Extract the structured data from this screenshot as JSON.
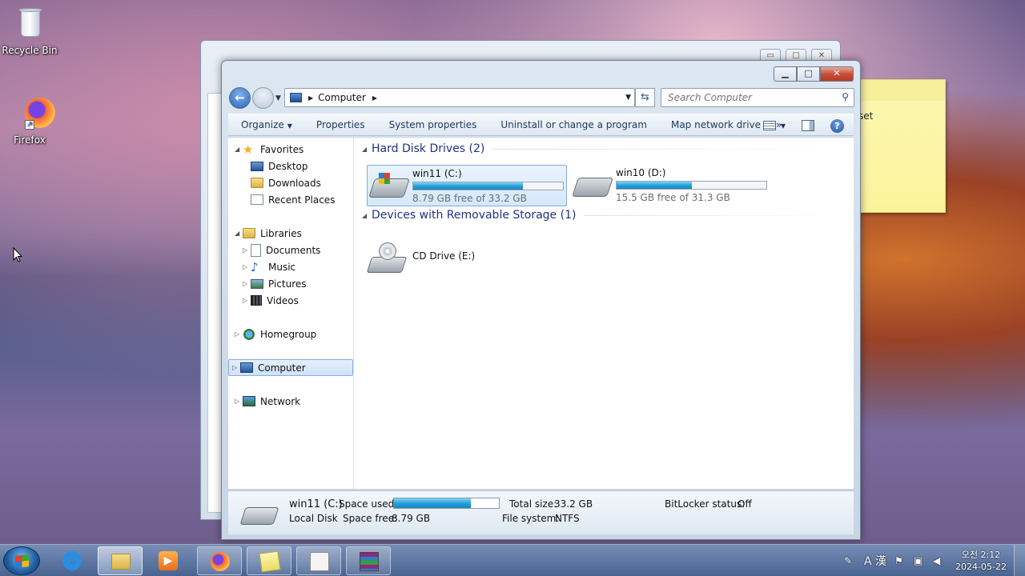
{
  "desktop": {
    "icons": [
      {
        "label": "Recycle Bin",
        "icon": "recycle-bin-icon"
      },
      {
        "label": "Firefox",
        "icon": "firefox-icon"
      }
    ],
    "sticky_note_text": "set"
  },
  "explorer": {
    "window_buttons": {
      "minimize": "▭",
      "maximize": "□",
      "close": "✕"
    },
    "address": {
      "crumb": "Computer",
      "search_placeholder": "Search Computer"
    },
    "toolbar": {
      "organize": "Organize",
      "properties": "Properties",
      "system_properties": "System properties",
      "uninstall": "Uninstall or change a program",
      "map_network_drive": "Map network drive",
      "more": "»"
    },
    "nav": {
      "favorites": "Favorites",
      "desktop": "Desktop",
      "downloads": "Downloads",
      "recent_places": "Recent Places",
      "libraries": "Libraries",
      "documents": "Documents",
      "music": "Music",
      "pictures": "Pictures",
      "videos": "Videos",
      "homegroup": "Homegroup",
      "computer": "Computer",
      "network": "Network"
    },
    "groups": {
      "hdd": "Hard Disk Drives (2)",
      "removable": "Devices with Removable Storage (1)"
    },
    "drives": [
      {
        "name": "win11 (C:)",
        "free": "8.79 GB free of 33.2 GB",
        "used_fraction": 0.735
      },
      {
        "name": "win10 (D:)",
        "free": "15.5 GB free of 31.3 GB",
        "used_fraction": 0.505
      }
    ],
    "cd_drive": "CD Drive (E:)",
    "details": {
      "name": "win11 (C:)",
      "type": "Local Disk",
      "space_used_label": "Space used:",
      "space_free_label": "Space free:",
      "space_free": "8.79 GB",
      "total_size_label": "Total size:",
      "total_size": "33.2 GB",
      "file_system_label": "File system:",
      "file_system": "NTFS",
      "bitlocker_label": "BitLocker status:",
      "bitlocker": "Off",
      "used_fraction": 0.735
    }
  },
  "taskbar": {
    "ime_text": "A 漢",
    "clock_time": "오전 2:12",
    "clock_date": "2024-05-22"
  }
}
